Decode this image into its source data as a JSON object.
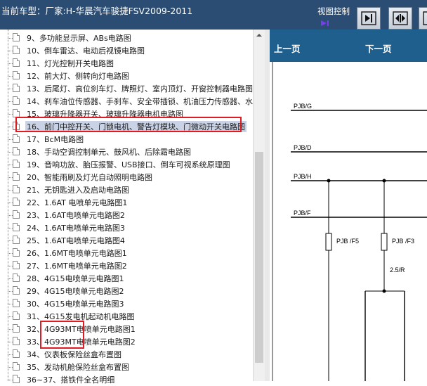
{
  "header": {
    "title": "当前车型：厂家:H-华晨汽车骏捷FSV2009-2011",
    "view_label": "视图控制",
    "play_icon": "play-arrow-icon",
    "view_buttons": [
      "collapse-right-icon",
      "split-view-icon",
      "expand-icon"
    ]
  },
  "tree": {
    "items": [
      {
        "label": "9、多功能显示屏、ABs电路图"
      },
      {
        "label": "10、倒车雷达、电动后视镜电路图"
      },
      {
        "label": "11、灯光控制开关电路图"
      },
      {
        "label": "12、前大灯、侧转向灯电路图"
      },
      {
        "label": "13、后尾灯、高位刹车灯、牌照灯、室内顶灯、开窗控制器电路图"
      },
      {
        "label": "14、刹车油位传感器、手刹车、安全带插锁、机油压力传感器、水"
      },
      {
        "label": "15、玻璃升降器开关、玻璃升降器电机电路图"
      },
      {
        "label": "16、前门中控开关、门锁电机、警告灯模块、门微动开关电路图",
        "selected": true
      },
      {
        "label": "17、BcM电路图"
      },
      {
        "label": "18、手动空调控制单元、鼓风机、后除霜电路图"
      },
      {
        "label": "19、音响功放、胎压报警、USB接口、倒车可视系统原理图"
      },
      {
        "label": "20、智能雨刷及灯光自动照明电路图"
      },
      {
        "label": "21、无钥匙进入及启动电路图"
      },
      {
        "label": "22、1.6AT 电喷单元电路图1"
      },
      {
        "label": "23、1.6AT电喷单元电路图2"
      },
      {
        "label": "24、1.6AT电喷单元电路图3"
      },
      {
        "label": "25、1.6AT电喷单元电路图4"
      },
      {
        "label": "26、1.6MT电喷单元电路图1"
      },
      {
        "label": "27、1.6MT电喷单元电路图2"
      },
      {
        "label": "28、4G15电喷单元电路图1"
      },
      {
        "label": "29、4G15电喷单元电路图2"
      },
      {
        "label": "30、4G15电喷单元电路图3"
      },
      {
        "label": "31、4G15发电机起动机电路图"
      },
      {
        "label": "32、4G93MT电喷单元电路图1"
      },
      {
        "label": "33、4G93MT电喷单元电路图2"
      },
      {
        "label": "34、仪表板保险丝盒布置图"
      },
      {
        "label": "35、发动机舱保险丝盒布置图"
      },
      {
        "label": "36~37、搭铁件全名明细"
      }
    ]
  },
  "nav": {
    "prev_label": "上一页",
    "next_label": "下一页"
  },
  "diagram": {
    "bus_labels": [
      "PJB/G",
      "PJB/D",
      "PJB/H",
      "PJB/F"
    ],
    "fuse_labels": [
      "PJB /F5",
      "PJB /F3"
    ],
    "wire_label": "2.5/R"
  },
  "colors": {
    "header_bg": "#2c4d73",
    "nav_bg": "#1e5f8e",
    "highlight_box": "#e01b24",
    "selection_bg": "#c9d3e5"
  }
}
